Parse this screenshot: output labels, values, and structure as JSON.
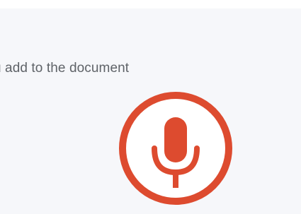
{
  "voice_typing": {
    "instruction_text": "u add to the document",
    "mic_button_icon": "microphone-icon",
    "accent_color": "#dd4b2f",
    "background_color": "#f6f7fa"
  }
}
